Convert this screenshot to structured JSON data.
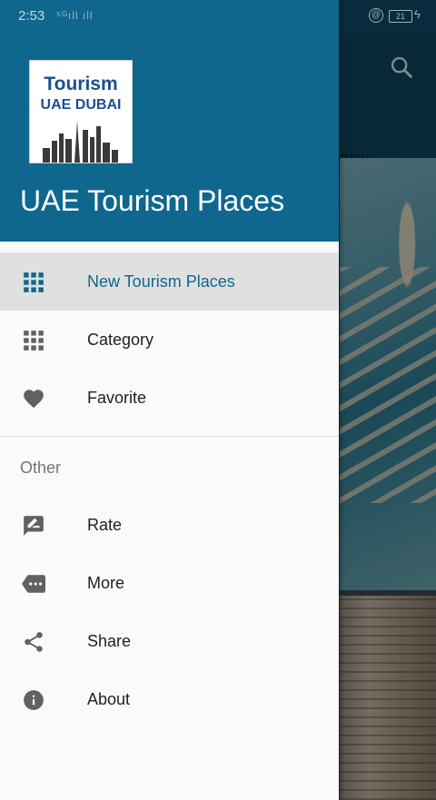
{
  "status_bar": {
    "time": "2:53",
    "signal": "⁵ᴳıll ıll",
    "battery": "21"
  },
  "drawer": {
    "app_title": "UAE Tourism Places",
    "logo": {
      "line1": "Tourism",
      "line2": "UAE DUBAI"
    },
    "items": [
      {
        "label": "New Tourism Places",
        "icon": "grid-icon",
        "active": true
      },
      {
        "label": "Category",
        "icon": "grid-icon",
        "active": false
      },
      {
        "label": "Favorite",
        "icon": "heart-icon",
        "active": false
      }
    ],
    "section_label": "Other",
    "other_items": [
      {
        "label": "Rate",
        "icon": "rate-review-icon"
      },
      {
        "label": "More",
        "icon": "more-icon"
      },
      {
        "label": "Share",
        "icon": "share-icon"
      },
      {
        "label": "About",
        "icon": "info-icon"
      }
    ]
  },
  "background": {
    "tab_fragment": "ORY"
  },
  "colors": {
    "primary": "#0f678d",
    "active_row": "#e0e0e0",
    "icon_gray": "#616161",
    "text": "#212121"
  }
}
